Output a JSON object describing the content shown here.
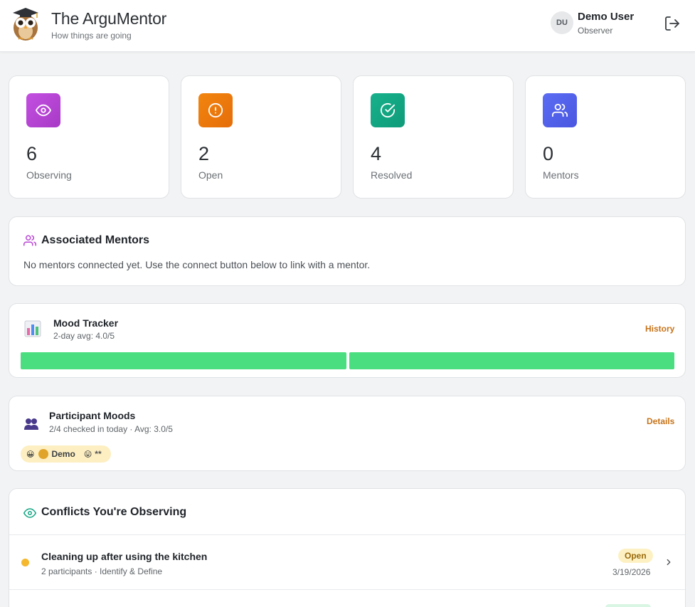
{
  "header": {
    "app_title": "The ArguMentor",
    "app_subtitle": "How things are going",
    "user": {
      "initials": "DU",
      "name": "Demo User",
      "role": "Observer"
    },
    "icons": {
      "logo": "owl-logo-icon",
      "logout": "logout-icon"
    }
  },
  "stats": [
    {
      "value": "6",
      "label": "Observing",
      "icon": "eye-icon",
      "color": "#b944d6"
    },
    {
      "value": "2",
      "label": "Open",
      "icon": "alert-circle-icon",
      "color": "#ea7a0c"
    },
    {
      "value": "4",
      "label": "Resolved",
      "icon": "check-circle-icon",
      "color": "#13a683"
    },
    {
      "value": "0",
      "label": "Mentors",
      "icon": "users-icon",
      "color": "#5262ea"
    }
  ],
  "mentors": {
    "title": "Associated Mentors",
    "empty_text": "No mentors connected yet. Use the connect button below to link with a mentor."
  },
  "mood_tracker": {
    "title": "Mood Tracker",
    "subtitle": "2-day avg: 4.0/5",
    "history_label": "History",
    "bar_color": "#4ade80"
  },
  "participant_moods": {
    "title": "Participant Moods",
    "subtitle": "2/4 checked in today · Avg: 3.0/5",
    "details_label": "Details",
    "chip": {
      "emoji_left": "😀",
      "name": "Demo",
      "emoji_right": "😛",
      "stars": "**"
    }
  },
  "conflicts": {
    "title": "Conflicts You're Observing",
    "items": [
      {
        "name": "Cleaning up after using the kitchen",
        "meta": "2 participants · Identify & Define",
        "status": "Open",
        "date": "3/19/2026"
      }
    ]
  }
}
